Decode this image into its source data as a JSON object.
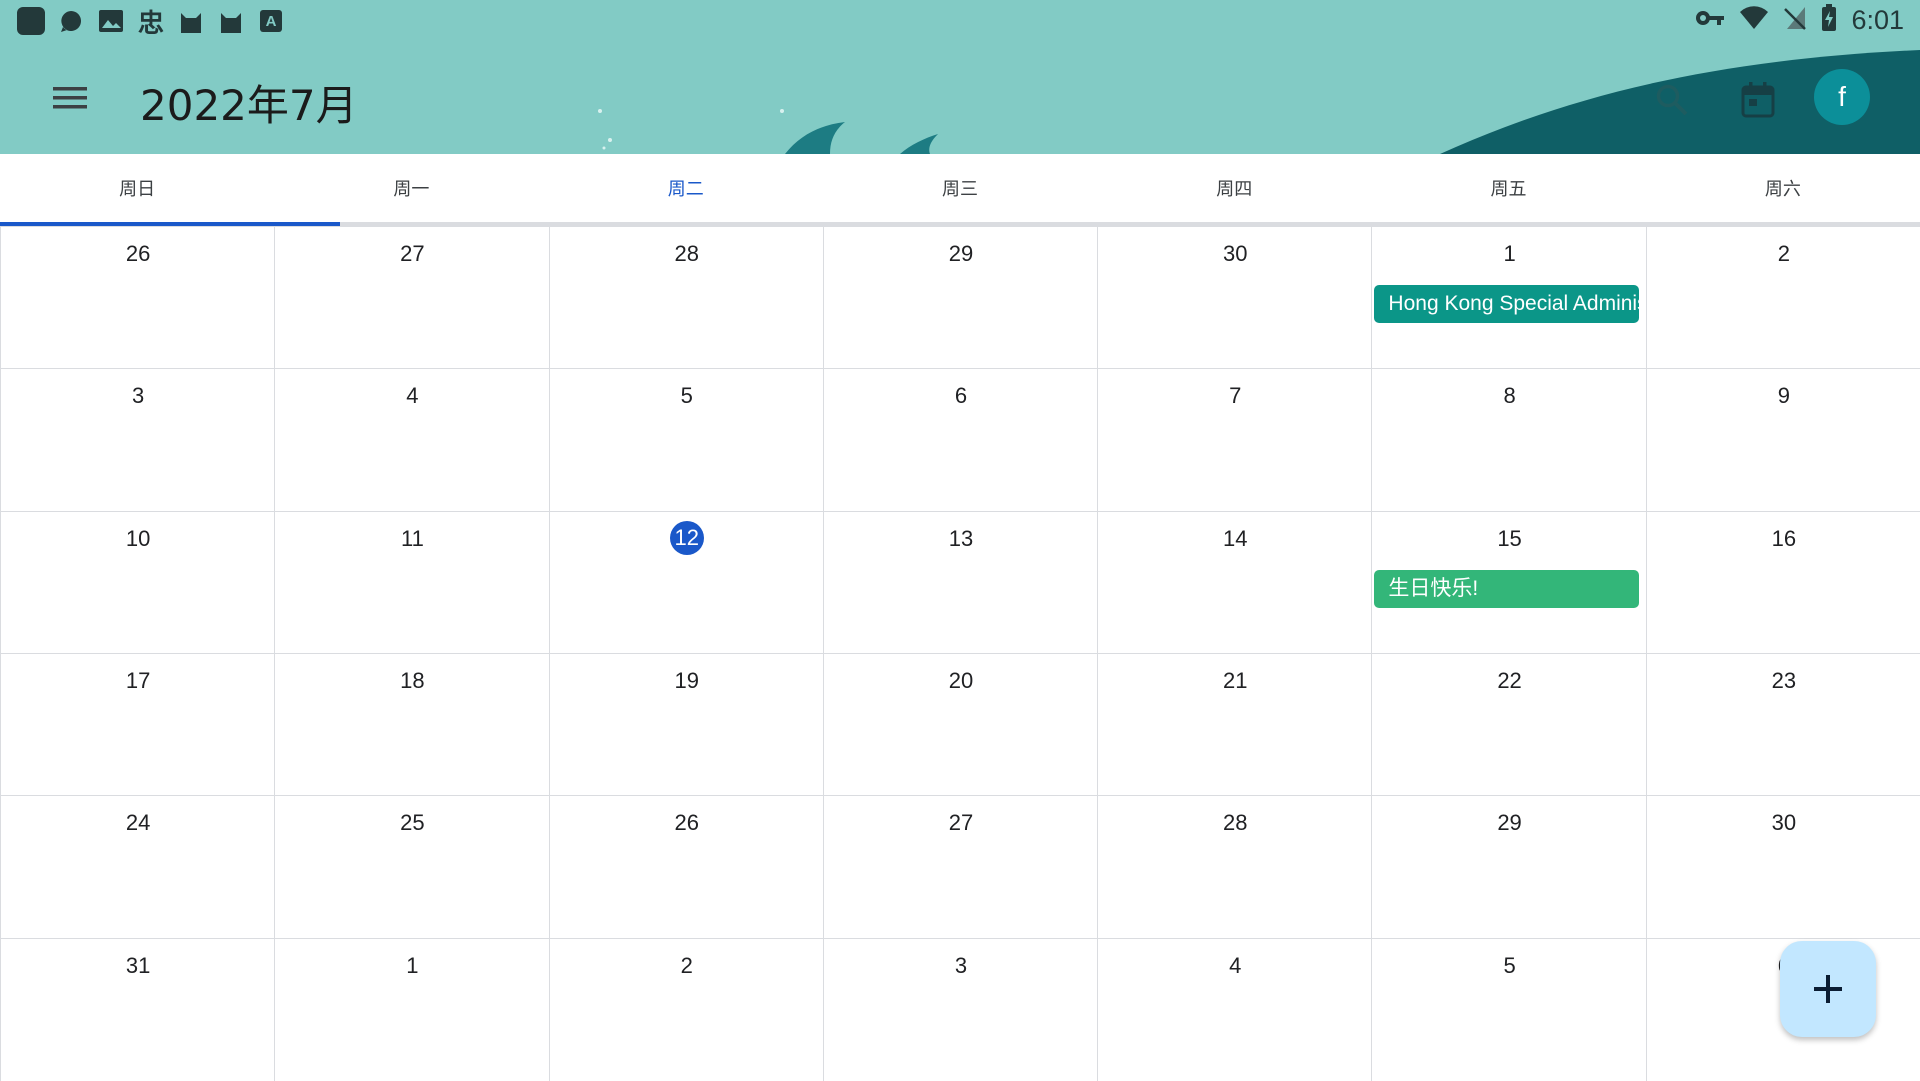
{
  "status_bar": {
    "left_icons": [
      "app-square-icon",
      "chat-bubble-icon",
      "image-icon",
      "chinese-char-icon",
      "cat-icon",
      "cat-icon",
      "text-a-icon"
    ],
    "chinese_char": "忠",
    "text_a": "A",
    "right_icons": [
      "vpn-key-icon",
      "wifi-icon",
      "no-sim-icon",
      "battery-charging-icon"
    ],
    "time": "6:01"
  },
  "app_bar": {
    "title": "2022年7月",
    "avatar_letter": "f",
    "header_color": "#82cbc5",
    "avatar_color": "#0c8f99"
  },
  "weekdays": [
    "周日",
    "周一",
    "周二",
    "周三",
    "周四",
    "周五",
    "周六"
  ],
  "today_weekday_index": 2,
  "weeks": [
    [
      "26",
      "27",
      "28",
      "29",
      "30",
      "1",
      "2"
    ],
    [
      "3",
      "4",
      "5",
      "6",
      "7",
      "8",
      "9"
    ],
    [
      "10",
      "11",
      "12",
      "13",
      "14",
      "15",
      "16"
    ],
    [
      "17",
      "18",
      "19",
      "20",
      "21",
      "22",
      "23"
    ],
    [
      "24",
      "25",
      "26",
      "27",
      "28",
      "29",
      "30"
    ],
    [
      "31",
      "1",
      "2",
      "3",
      "4",
      "5",
      "6"
    ]
  ],
  "today": {
    "week": 2,
    "day": 2
  },
  "events": [
    {
      "week": 0,
      "day": 5,
      "title": "Hong Kong Special Administrative Region Establishment Day",
      "color": "#0b9688"
    },
    {
      "week": 2,
      "day": 5,
      "title": "生日快乐!",
      "color": "#33b679"
    }
  ],
  "accent_color": "#1a58c9",
  "fab_icon": "plus-icon"
}
